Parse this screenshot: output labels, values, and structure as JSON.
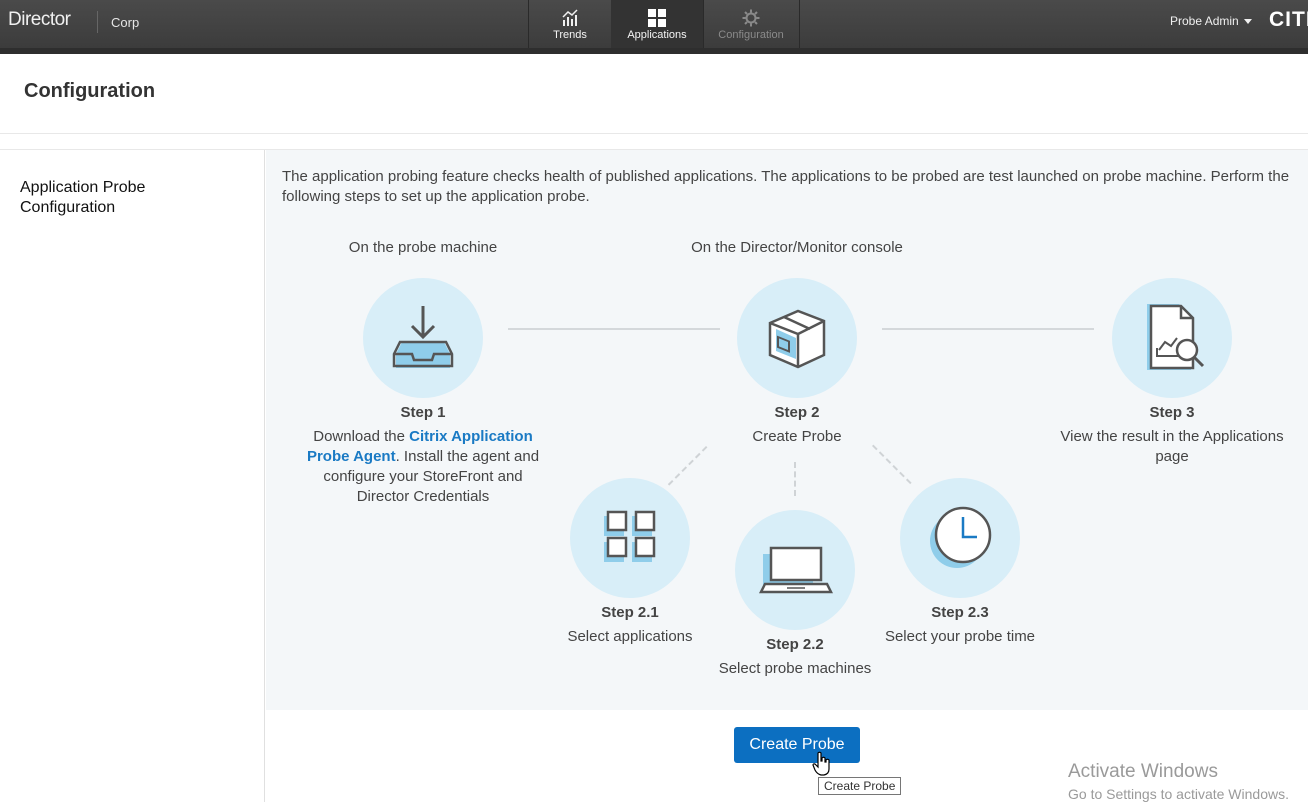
{
  "topbar": {
    "brand": "Director",
    "site": "Corp",
    "nav": [
      {
        "label": "Trends",
        "icon": "trends-icon"
      },
      {
        "label": "Applications",
        "icon": "applications-grid-icon"
      },
      {
        "label": "Configuration",
        "icon": "gear-icon"
      }
    ],
    "user_menu": "Probe Admin",
    "logo_text": "CITR"
  },
  "page": {
    "title": "Configuration"
  },
  "sidebar": {
    "items": [
      {
        "label": "Application Probe Configuration"
      }
    ]
  },
  "main": {
    "intro": "The application probing feature checks health of published applications. The applications to be probed are test launched on probe machine. Perform the following steps to set up the application probe.",
    "heading_probe_machine": "On the probe machine",
    "heading_console": "On the Director/Monitor console",
    "steps": {
      "s1": {
        "label": "Step 1",
        "desc_before": "Download the ",
        "link": "Citrix Application Probe Agent",
        "desc_after": ". Install the agent and configure your StoreFront and Director Credentials"
      },
      "s2": {
        "label": "Step 2",
        "desc": "Create Probe"
      },
      "s3": {
        "label": "Step 3",
        "desc": "View the result in the Applications page"
      },
      "s21": {
        "label": "Step 2.1",
        "desc": "Select applications"
      },
      "s22": {
        "label": "Step 2.2",
        "desc": "Select probe machines"
      },
      "s23": {
        "label": "Step 2.3",
        "desc": "Select your probe time"
      }
    }
  },
  "actions": {
    "create_probe": "Create Probe",
    "tooltip": "Create Probe"
  },
  "watermark": {
    "title": "Activate Windows",
    "subtitle": "Go to Settings to activate Windows."
  },
  "colors": {
    "accent": "#0c6fc1",
    "link": "#1a7ac4",
    "circle_bg": "#d8eef8",
    "icon_blue": "#8fcdea"
  }
}
